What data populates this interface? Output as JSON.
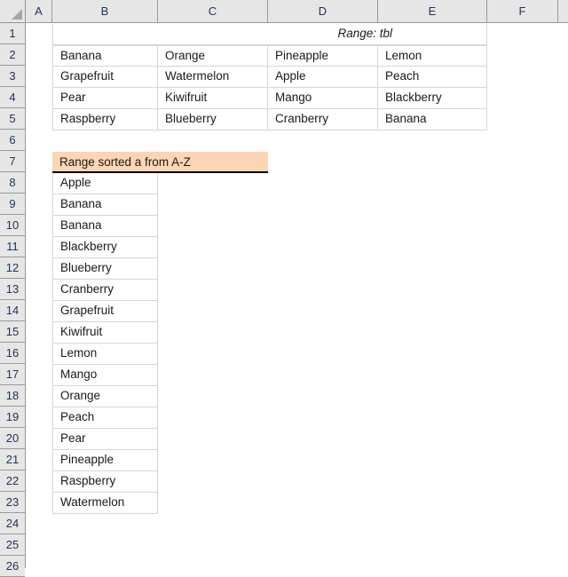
{
  "app": {
    "type": "spreadsheet",
    "select_all_icon": "select-all-triangle-icon"
  },
  "grid": {
    "columns": [
      "A",
      "B",
      "C",
      "D",
      "E",
      "F"
    ],
    "rows": [
      "1",
      "2",
      "3",
      "4",
      "5",
      "6",
      "7",
      "8",
      "9",
      "10",
      "11",
      "12",
      "13",
      "14",
      "15",
      "16",
      "17",
      "18",
      "19",
      "20",
      "21",
      "22",
      "23",
      "24",
      "25",
      "26"
    ]
  },
  "range_table": {
    "title": "Range: tbl",
    "rows": [
      [
        "Banana",
        "Orange",
        "Pineapple",
        "Lemon"
      ],
      [
        "Grapefruit",
        "Watermelon",
        "Apple",
        "Peach"
      ],
      [
        "Pear",
        "Kiwifruit",
        "Mango",
        "Blackberry"
      ],
      [
        "Raspberry",
        "Blueberry",
        "Cranberry",
        "Banana"
      ]
    ]
  },
  "sorted_list": {
    "header": "Range sorted a from A-Z",
    "header_fill": "#fcd5b4",
    "items": [
      "Apple",
      "Banana",
      "Banana",
      "Blackberry",
      "Blueberry",
      "Cranberry",
      "Grapefruit",
      "Kiwifruit",
      "Lemon",
      "Mango",
      "Orange",
      "Peach",
      "Pear",
      "Pineapple",
      "Raspberry",
      "Watermelon"
    ]
  }
}
